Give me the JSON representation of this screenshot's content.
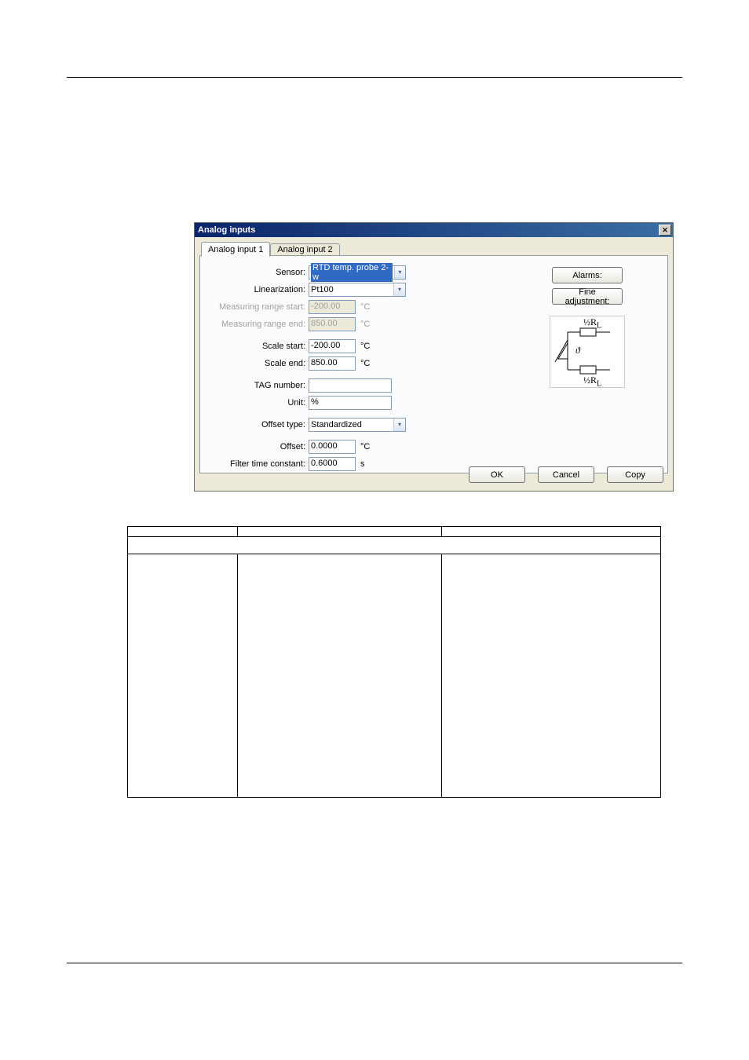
{
  "dialog": {
    "title": "Analog inputs",
    "tabs": [
      {
        "label": "Analog input 1",
        "active": true
      },
      {
        "label": "Analog input 2",
        "active": false
      }
    ],
    "fields": {
      "sensor": {
        "label": "Sensor:",
        "value": "RTD temp. probe 2-w"
      },
      "linearization": {
        "label": "Linearization:",
        "value": "Pt100"
      },
      "meas_start": {
        "label": "Measuring range start:",
        "value": "-200.00",
        "unit": "°C"
      },
      "meas_end": {
        "label": "Measuring range end:",
        "value": "850.00",
        "unit": "°C"
      },
      "scale_start": {
        "label": "Scale start:",
        "value": "-200.00",
        "unit": "°C"
      },
      "scale_end": {
        "label": "Scale end:",
        "value": "850.00",
        "unit": "°C"
      },
      "tag_number": {
        "label": "TAG number:",
        "value": ""
      },
      "unit": {
        "label": "Unit:",
        "value": "%"
      },
      "offset_type": {
        "label": "Offset type:",
        "value": "Standardized"
      },
      "offset": {
        "label": "Offset:",
        "value": "0.0000",
        "unit": "°C"
      },
      "filter": {
        "label": "Filter time constant:",
        "value": "0.6000",
        "unit": "s"
      }
    },
    "right": {
      "alarms": "Alarms:",
      "fine_adjustment": "Fine adjustment:"
    },
    "diagram": {
      "top": "½R",
      "topSub": "L",
      "bottom": "½R",
      "bottomSub": "L",
      "theta": "ϑ"
    },
    "buttons": {
      "ok": "OK",
      "cancel": "Cancel",
      "copy": "Copy"
    }
  },
  "table": {
    "headers": {
      "c1": "",
      "c2": "",
      "c3": ""
    },
    "fullrow": "",
    "rows": [
      {
        "c1": "",
        "c2": "",
        "c3": ""
      }
    ]
  }
}
